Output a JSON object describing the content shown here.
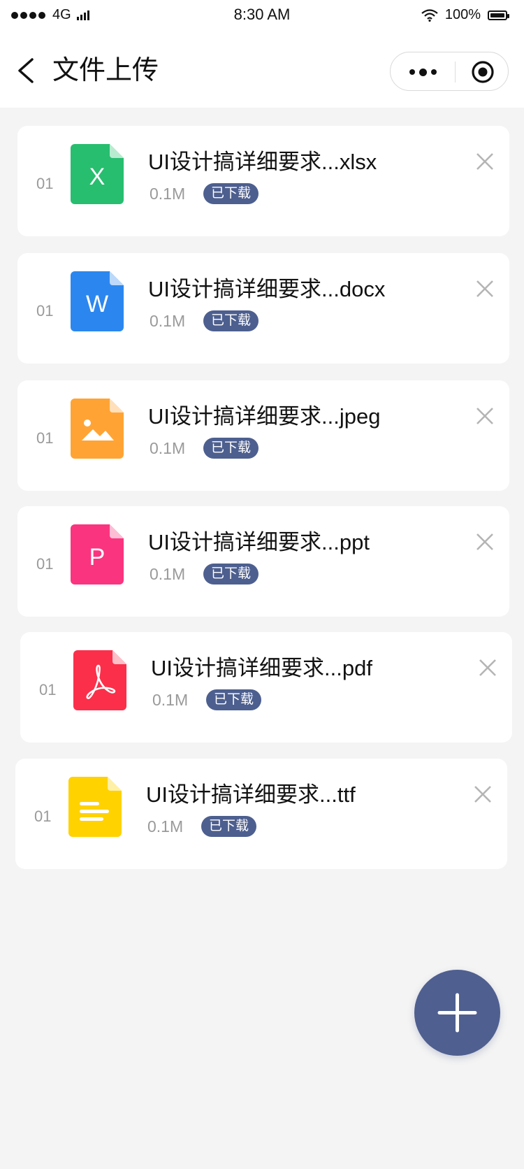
{
  "status_bar": {
    "network": "4G",
    "time": "8:30 AM",
    "battery": "100%"
  },
  "header": {
    "title": "文件上传"
  },
  "files": [
    {
      "index": "01",
      "name": "UI设计搞详细要求...xlsx",
      "size": "0.1M",
      "status": "已下载",
      "icon": "excel-icon",
      "icon_letter": "X",
      "color": "#27be6f"
    },
    {
      "index": "01",
      "name": "UI设计搞详细要求...docx",
      "size": "0.1M",
      "status": "已下载",
      "icon": "word-icon",
      "icon_letter": "W",
      "color": "#2b87ef"
    },
    {
      "index": "01",
      "name": "UI设计搞详细要求...jpeg",
      "size": "0.1M",
      "status": "已下载",
      "icon": "image-icon",
      "icon_letter": "",
      "color": "#ffa434"
    },
    {
      "index": "01",
      "name": "UI设计搞详细要求...ppt",
      "size": "0.1M",
      "status": "已下载",
      "icon": "ppt-icon",
      "icon_letter": "P",
      "color": "#fb347f"
    },
    {
      "index": "01",
      "name": "UI设计搞详细要求...pdf",
      "size": "0.1M",
      "status": "已下载",
      "icon": "pdf-icon",
      "icon_letter": "",
      "color": "#fb2f4a"
    },
    {
      "index": "01",
      "name": "UI设计搞详细要求...ttf",
      "size": "0.1M",
      "status": "已下载",
      "icon": "text-file-icon",
      "icon_letter": "",
      "color": "#ffd200"
    }
  ],
  "colors": {
    "accent": "#4f5f8f",
    "background": "#f4f4f4"
  }
}
